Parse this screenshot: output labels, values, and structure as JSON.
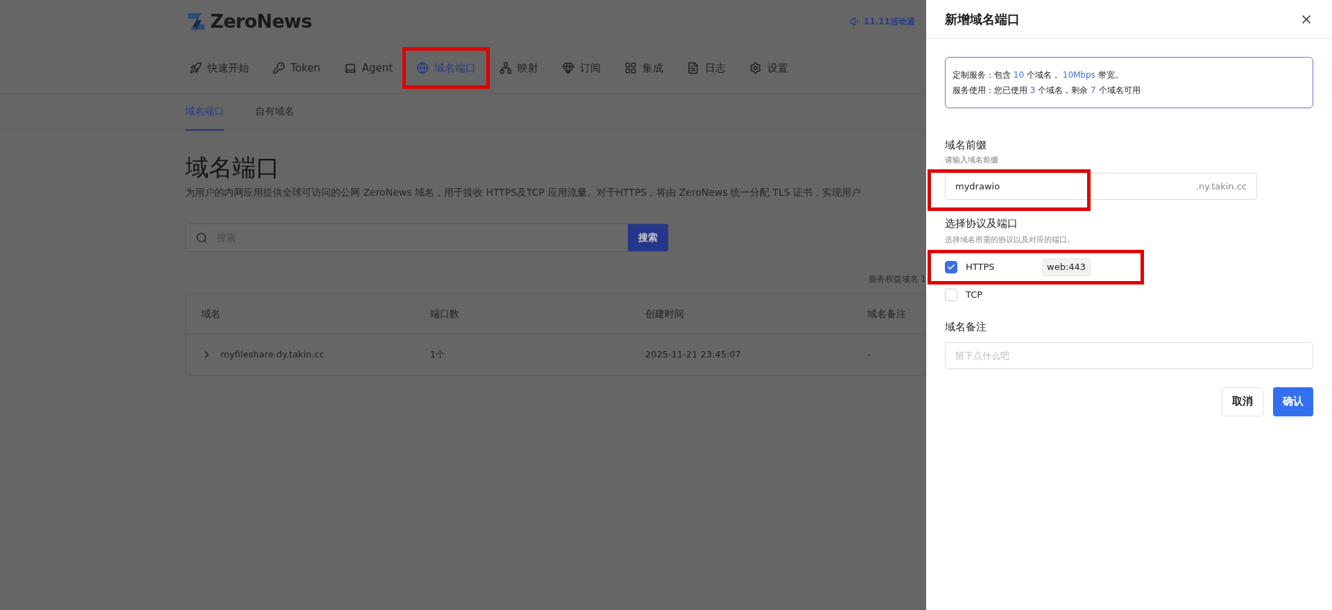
{
  "brand": {
    "name": "ZeroNews"
  },
  "announcement": {
    "text": "11.11活动通"
  },
  "nav": [
    {
      "label": "快速开始",
      "selected": false,
      "highlighted": false
    },
    {
      "label": "Token",
      "selected": false,
      "highlighted": false
    },
    {
      "label": "Agent",
      "selected": false,
      "highlighted": false
    },
    {
      "label": "域名端口",
      "selected": true,
      "highlighted": true
    },
    {
      "label": "映射",
      "selected": false,
      "highlighted": false
    },
    {
      "label": "订阅",
      "selected": false,
      "highlighted": false
    },
    {
      "label": "集成",
      "selected": false,
      "highlighted": false
    },
    {
      "label": "日志",
      "selected": false,
      "highlighted": false
    },
    {
      "label": "设置",
      "selected": false,
      "highlighted": false
    }
  ],
  "subtabs": [
    {
      "label": "域名端口",
      "selected": true
    },
    {
      "label": "自有域名",
      "selected": false
    }
  ],
  "page": {
    "title": "域名端口",
    "description": "为用户的内网应用提供全球可访问的公网 ZeroNews 域名，用于接收 HTTPS及TCP 应用流量。对于HTTPS，将由 ZeroNews 统一分配 TLS 证书，实现用户"
  },
  "search": {
    "placeholder": "搜索",
    "button": "搜索"
  },
  "quota_note": "服务权益域名 1",
  "table": {
    "columns": [
      "域名",
      "端口数",
      "创建时间",
      "域名备注"
    ],
    "rows": [
      {
        "expanded": false,
        "cells": [
          "myfileshare.dy.takin.cc",
          "1个",
          "2025-11-21 23:45:07",
          "-"
        ]
      }
    ]
  },
  "drawer": {
    "title": "新增域名端口",
    "info": [
      [
        {
          "text": "定制服务：包含 ",
          "accent": false
        },
        {
          "text": "10",
          "accent": true
        },
        {
          "text": " 个域名， ",
          "accent": false
        },
        {
          "text": "10Mbps",
          "accent": true
        },
        {
          "text": " 带宽。",
          "accent": false
        }
      ],
      [
        {
          "text": "服务使用：您已使用 ",
          "accent": false
        },
        {
          "text": "3",
          "accent": true
        },
        {
          "text": " 个域名，剩余 ",
          "accent": false
        },
        {
          "text": "7",
          "accent": true
        },
        {
          "text": " 个域名可用",
          "accent": false
        }
      ]
    ],
    "prefix": {
      "label": "域名前缀",
      "hint": "请输入域名前缀",
      "value": "mydrawio",
      "suffix": ".ny.takin.cc",
      "highlighted": true
    },
    "protocols": {
      "label": "选择协议及端口",
      "hint": "选择域名所需的协议以及对应的端口。",
      "items": [
        {
          "name": "HTTPS",
          "checked": true,
          "port": "web:443",
          "highlighted": true
        },
        {
          "name": "TCP",
          "checked": false,
          "highlighted": false
        }
      ]
    },
    "remark": {
      "label": "域名备注",
      "placeholder": "留下点什么吧"
    },
    "buttons": [
      {
        "label": "取消",
        "kind": "secondary"
      },
      {
        "label": "确认",
        "kind": "primary"
      }
    ]
  }
}
